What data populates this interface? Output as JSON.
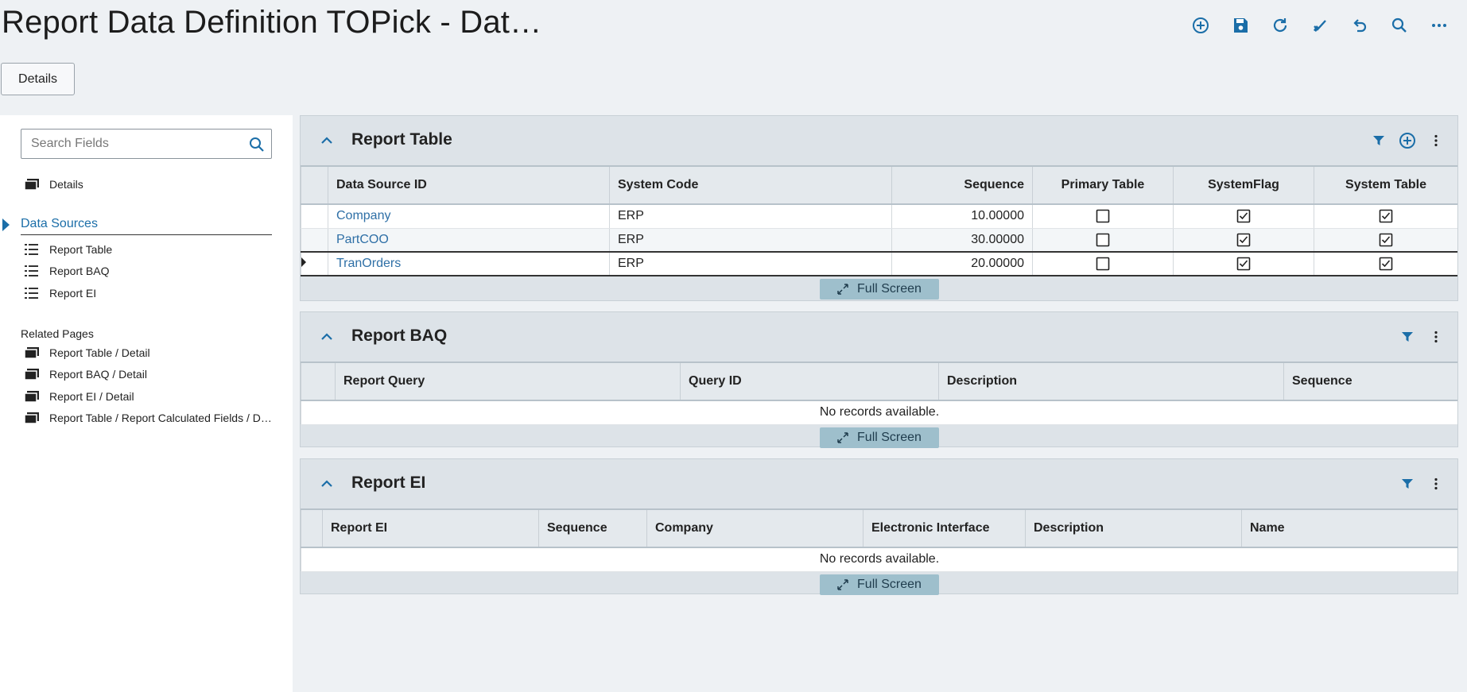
{
  "header": {
    "title": "Report Data Definition TOPick - Dat…",
    "toolbar": [
      {
        "name": "add-icon"
      },
      {
        "name": "save-icon"
      },
      {
        "name": "refresh-icon"
      },
      {
        "name": "clear-icon"
      },
      {
        "name": "undo-icon"
      },
      {
        "name": "search-icon"
      },
      {
        "name": "more-icon"
      }
    ]
  },
  "tabs": {
    "details": "Details"
  },
  "sidebar": {
    "search_placeholder": "Search Fields",
    "details_label": "Details",
    "data_sources_label": "Data Sources",
    "data_sources": [
      "Report Table",
      "Report BAQ",
      "Report EI"
    ],
    "related_label": "Related Pages",
    "related": [
      "Report Table / Detail",
      "Report BAQ / Detail",
      "Report EI / Detail",
      "Report Table / Report Calculated Fields / D…"
    ]
  },
  "report_table": {
    "title": "Report Table",
    "columns": [
      "Data Source ID",
      "System Code",
      "Sequence",
      "Primary Table",
      "SystemFlag",
      "System Table"
    ],
    "rows": [
      {
        "id": "Company",
        "code": "ERP",
        "seq": "10.00000",
        "primary": false,
        "sysflag": true,
        "systable": true
      },
      {
        "id": "PartCOO",
        "code": "ERP",
        "seq": "30.00000",
        "primary": false,
        "sysflag": true,
        "systable": true
      },
      {
        "id": "TranOrders",
        "code": "ERP",
        "seq": "20.00000",
        "primary": false,
        "sysflag": true,
        "systable": true
      }
    ],
    "full_screen": "Full Screen"
  },
  "report_baq": {
    "title": "Report BAQ",
    "columns": [
      "Report Query",
      "Query ID",
      "Description",
      "Sequence"
    ],
    "empty": "No records available.",
    "full_screen": "Full Screen"
  },
  "report_ei": {
    "title": "Report EI",
    "columns": [
      "Report EI",
      "Sequence",
      "Company",
      "Electronic Interface",
      "Description",
      "Name"
    ],
    "empty": "No records available.",
    "full_screen": "Full Screen"
  },
  "colors": {
    "accent": "#1b6ea8",
    "panel_bg": "#dde3e8",
    "fullscreen_btn": "#9ebfcc",
    "link": "#2e6fa6"
  }
}
